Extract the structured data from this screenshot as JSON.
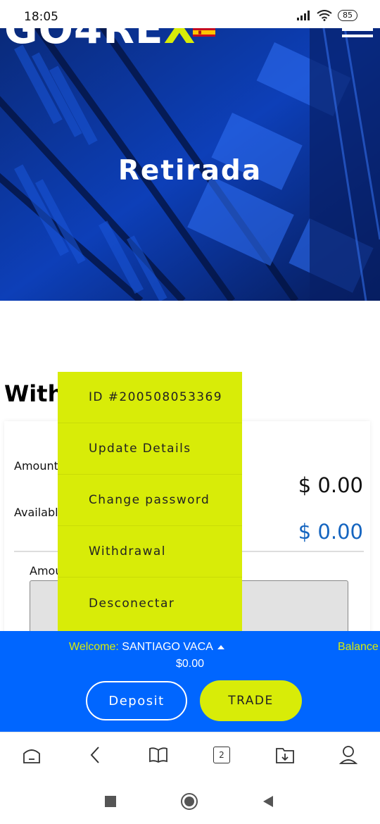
{
  "status_bar": {
    "time": "18:05",
    "battery": "85"
  },
  "header": {
    "logo_text": "GO4RE",
    "logo_accent": "X",
    "hero_title": "Retirada"
  },
  "page": {
    "heading": "With",
    "amount_label": "Amount",
    "amount_value": "$ 0.00",
    "available_label": "Availabl",
    "available_value": "$ 0.00",
    "field_label": "Amou"
  },
  "dropdown": {
    "items": [
      {
        "label": "ID #200508053369"
      },
      {
        "label": "Update Details"
      },
      {
        "label": "Change password"
      },
      {
        "label": "Withdrawal"
      },
      {
        "label": "Desconectar"
      }
    ]
  },
  "bottom_bar": {
    "welcome_prefix": "Welcome: ",
    "user_name": "SANTIAGO VACA",
    "balance_label": "Balance",
    "balance_value": "$0.00",
    "deposit_label": "Deposit",
    "trade_label": "TRADE"
  },
  "browser_bar": {
    "tabs_count": "2"
  },
  "colors": {
    "accent": "#d8ec08",
    "bar_blue": "#0066ff",
    "hero_blue": "#0b2c8e",
    "available_blue": "#1565c0"
  }
}
